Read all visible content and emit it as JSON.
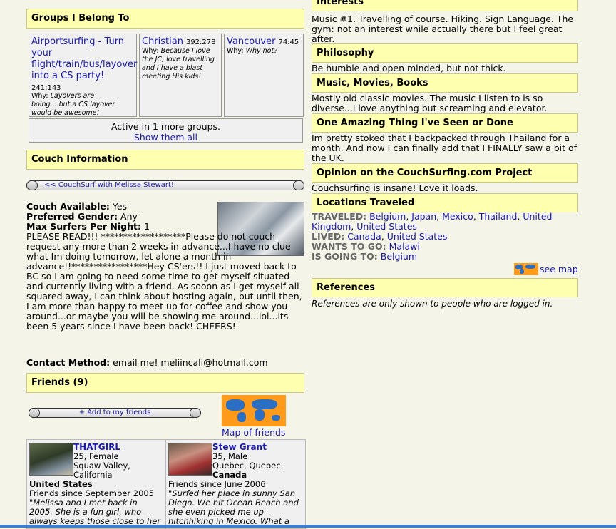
{
  "groups": {
    "header": "Groups I Belong To",
    "items": [
      {
        "name": "Airportsurfing - Turn your flight/train/bus/layover into a CS party!",
        "count": "241:143",
        "why_label": "Why:",
        "why": "Layovers are boing....but a CS layover would be awesome!"
      },
      {
        "name": "Christian",
        "count": "392:278",
        "why_label": "Why:",
        "why": "Because I love the JC, love travelling and I have a blast meeting His kids!"
      },
      {
        "name": "Vancouver",
        "count": "74:45",
        "why_label": "Why:",
        "why": "Why not?"
      }
    ],
    "more_text": "Active in 1 more groups.",
    "show_all": "Show them all"
  },
  "couch": {
    "header": "Couch Information",
    "couchsurf_button": "<< CouchSurf with Melissa Stewart!",
    "available_label": "Couch Available:",
    "available_value": "Yes",
    "gender_label": "Preferred Gender:",
    "gender_value": "Any",
    "max_label": "Max Surfers Per Night:",
    "max_value": "1",
    "description": "PLEASE READ!!! *******************Please do not couch request any more than 2 weeks in advance...I have no clue what Im doing tomorrow, let alone a month in advance!!*****************Hey CS'ers!! I just moved back to BC so I am going to need some time to get myself situated and currently living with a friend. As sooon as I get myself all squared away, I can think about hosting again, but until then, I am more than happy to meet up for coffee and show you around...or maybe you will be showing me around...lol...its been 5 years since I have been back! CHEERS!",
    "contact_label": "Contact Method:",
    "contact_value": "email me! meliincali@hotmail.com"
  },
  "friends": {
    "header": "Friends (9)",
    "add_button": "+ Add to my friends",
    "map_link": "Map of friends",
    "list": [
      {
        "name": "THATGIRL",
        "line1": "25, Female",
        "line2": "Squaw Valley, California",
        "country": "United States",
        "since": "Friends since September 2005",
        "quote": "\"Melissa and I met back in 2005. She is a fun girl, who always keeps those close to her"
      },
      {
        "name": "Stew Grant",
        "line1": "35, Male",
        "line2": "Quebec, Quebec",
        "country": "Canada",
        "since": "Friends since June 2006",
        "quote": "\"Surfed her place in sunny San Diego. We hit Ocean Beach and she even picked me up hitchhiking in Mexico. What a"
      }
    ]
  },
  "interests": {
    "header": "Interests",
    "text": "Music #1. Travelling of course. Hiking. Sign Language. The gym: not an interest while actually there but I feel great after."
  },
  "philosophy": {
    "header": "Philosophy",
    "text": "Be humble and open minded, but not thick."
  },
  "music": {
    "header": "Music, Movies, Books",
    "text": "Mostly old classic movies. The music I listen to is so diverse...I love anything but screaming and elevator."
  },
  "amazing": {
    "header": "One Amazing Thing I've Seen or Done",
    "text": "Im pretty stoked that I backpacked through Thailand for a month. And now I can finally add that I FINALLY saw a bit of the UK."
  },
  "opinion": {
    "header": "Opinion on the CouchSurfing.com Project",
    "text": "Couchsurfing is insane! Love it loads."
  },
  "locations": {
    "header": "Locations Traveled",
    "traveled_label": "TRAVELED:",
    "traveled": [
      "Belgium",
      "Japan",
      "Mexico",
      "Thailand",
      "United Kingdom",
      "United States"
    ],
    "lived_label": "LIVED:",
    "lived": [
      "Canada",
      "United States"
    ],
    "wants_label": "WANTS TO GO:",
    "wants": [
      "Malawi"
    ],
    "going_label": "IS GOING TO:",
    "going": [
      "Belgium"
    ],
    "see_map": "see map"
  },
  "references": {
    "header": "References",
    "text": "References are only shown to people who are logged in."
  },
  "colors": {
    "header_bg": "#ffffb0",
    "link": "#1a1aa6",
    "page_bg": "#f5f4e8"
  }
}
